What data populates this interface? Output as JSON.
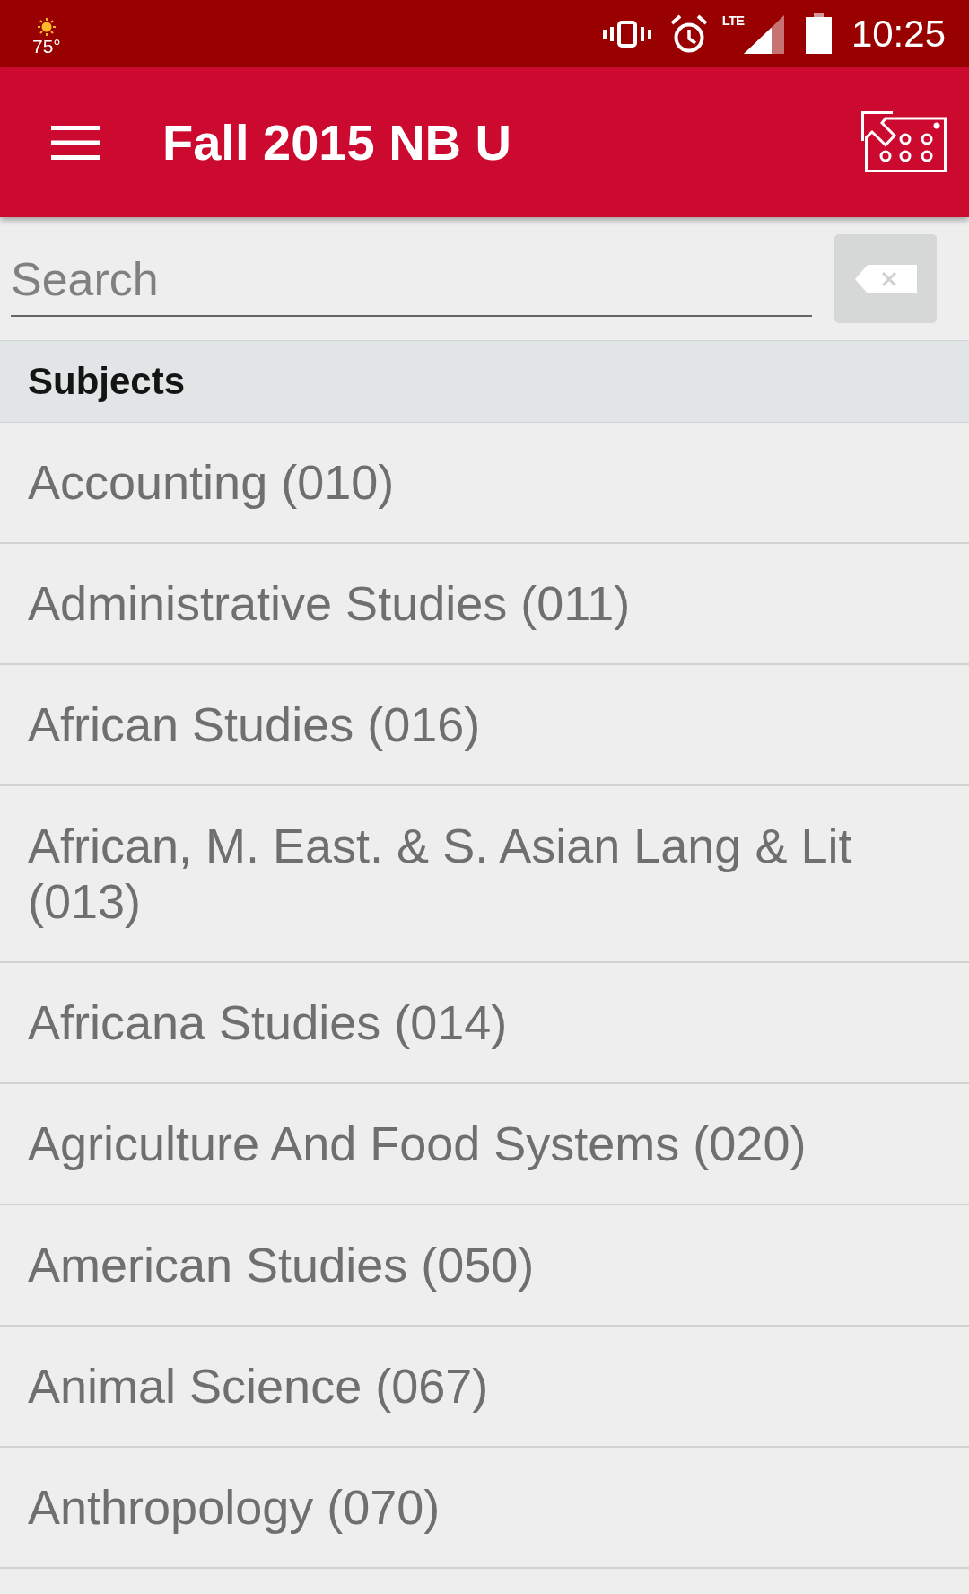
{
  "status_bar": {
    "temperature": "75°",
    "network": "LTE",
    "time": "10:25"
  },
  "app_bar": {
    "title": "Fall 2015 NB U"
  },
  "search": {
    "placeholder": "Search"
  },
  "section": {
    "title": "Subjects"
  },
  "subjects": [
    "Accounting (010)",
    "Administrative Studies (011)",
    "African Studies (016)",
    "African, M. East. & S. Asian Lang & Lit (013)",
    "Africana Studies (014)",
    "Agriculture And Food Systems (020)",
    "American Studies (050)",
    "Animal Science (067)",
    "Anthropology (070)"
  ]
}
